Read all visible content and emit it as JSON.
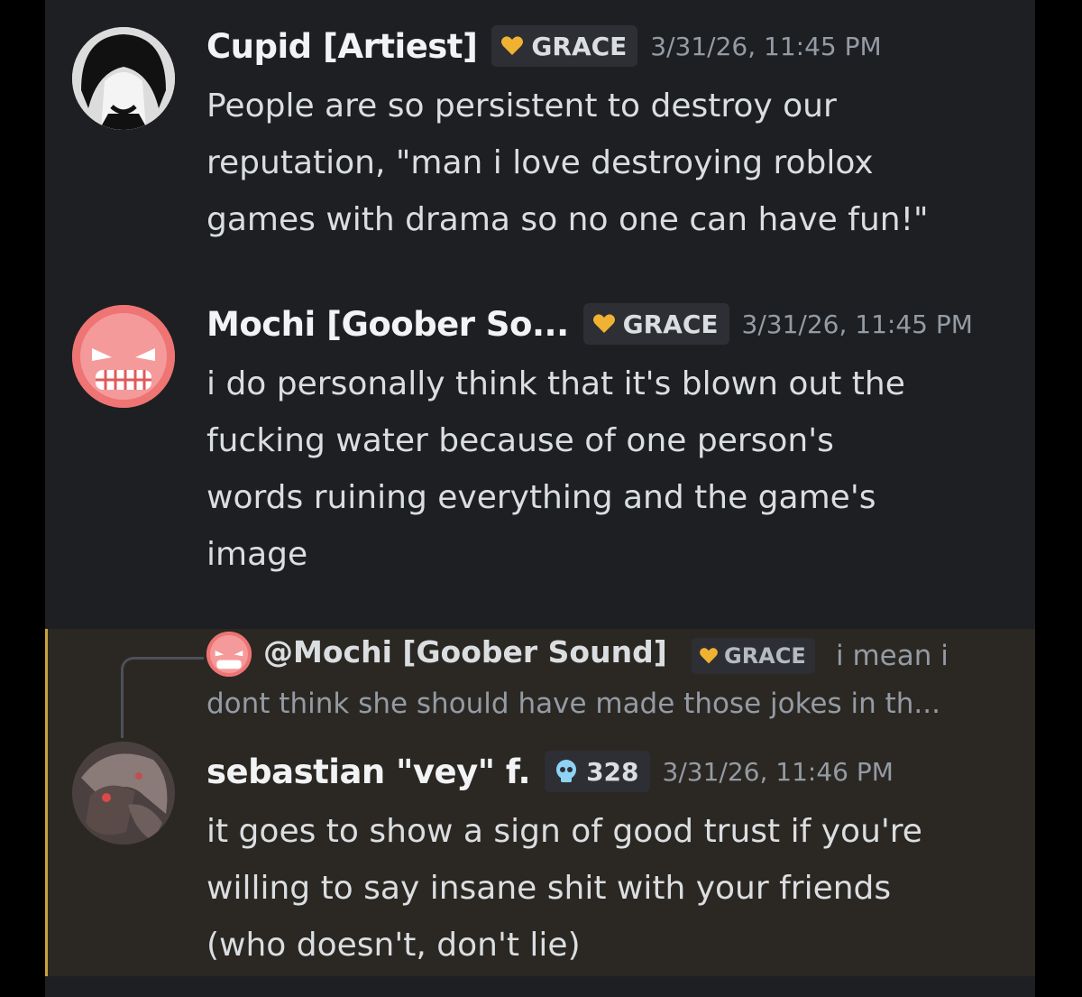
{
  "messages": [
    {
      "username": "Cupid [Artiest]",
      "tag": "GRACE",
      "timestamp": "3/31/26, 11:45 PM",
      "lines": [
        "People are so persistent to destroy our",
        "reputation, \"man i love destroying roblox",
        "games with drama so no one can have fun!\""
      ]
    },
    {
      "username": "Mochi [Goober So...",
      "tag": "GRACE",
      "timestamp": "3/31/26, 11:45 PM",
      "lines": [
        "i do personally think that it's blown out the",
        "fucking water because of one person's",
        "words ruining everything and the game's",
        "image"
      ]
    },
    {
      "reply": {
        "name": "@Mochi [Goober Sound]",
        "tag": "GRACE",
        "text_line1": "i mean i",
        "text_line2": "dont think she should have made those jokes in th..."
      },
      "username": "sebastian \"vey\" f.",
      "tag": "328",
      "timestamp": "3/31/26, 11:46 PM",
      "lines": [
        "it goes to show a sign of good trust if you're",
        "willing to say insane shit with your friends",
        "(who doesn't, don't lie)"
      ]
    }
  ],
  "icons": {
    "guild_tag_grace": "heart-icon",
    "guild_tag_328": "skull-icon"
  },
  "colors": {
    "background": "#1e1f22",
    "highlight": "#2b2823",
    "highlight_bar": "#c9a13e",
    "heart": "#f0b232",
    "skull": "#8fd3f4"
  }
}
